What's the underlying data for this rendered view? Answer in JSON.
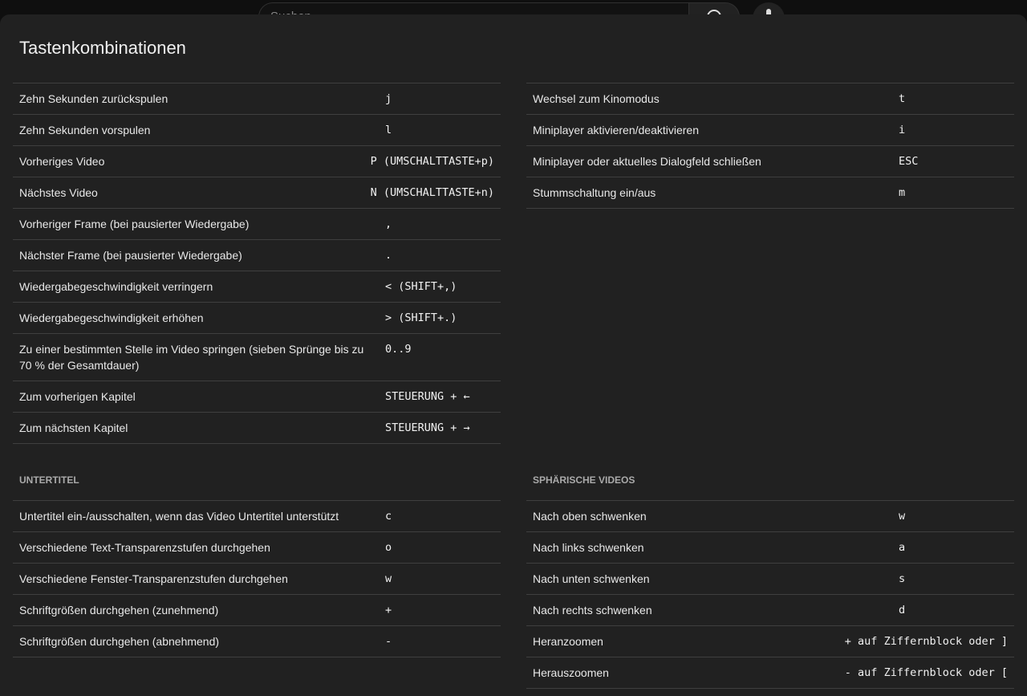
{
  "masthead": {
    "search_placeholder": "Suchen"
  },
  "dialog": {
    "title": "Tastenkombinationen"
  },
  "left_top": [
    {
      "label": "Zehn Sekunden zurückspulen",
      "key": "j"
    },
    {
      "label": "Zehn Sekunden vorspulen",
      "key": "l"
    },
    {
      "label": "Vorheriges Video",
      "key": "P (UMSCHALTTASTE+p)"
    },
    {
      "label": "Nächstes Video",
      "key": "N (UMSCHALTTASTE+n)"
    },
    {
      "label": "Vorheriger Frame (bei pausierter Wiedergabe)",
      "key": ","
    },
    {
      "label": "Nächster Frame (bei pausierter Wiedergabe)",
      "key": "."
    },
    {
      "label": "Wiedergabegeschwindigkeit verringern",
      "key": "< (SHIFT+,)"
    },
    {
      "label": "Wiedergabegeschwindigkeit erhöhen",
      "key": "> (SHIFT+.)"
    },
    {
      "label": "Zu einer bestimmten Stelle im Video springen (sieben Sprünge bis zu 70 % der Gesamtdauer)",
      "key": "0..9"
    },
    {
      "label": "Zum vorherigen Kapitel",
      "key": "STEUERUNG + ←"
    },
    {
      "label": "Zum nächsten Kapitel",
      "key": "STEUERUNG + →"
    }
  ],
  "right_top": [
    {
      "label": "Wechsel zum Kinomodus",
      "key": "t"
    },
    {
      "label": "Miniplayer aktivieren/deaktivieren",
      "key": "i"
    },
    {
      "label": "Miniplayer oder aktuelles Dialogfeld schließen",
      "key": "ESC"
    },
    {
      "label": "Stummschaltung ein/aus",
      "key": "m"
    }
  ],
  "subtitles": {
    "heading": "Untertitel",
    "rows": [
      {
        "label": "Untertitel ein-/ausschalten, wenn das Video Untertitel unterstützt",
        "key": "c"
      },
      {
        "label": "Verschiedene Text-Transparenzstufen durchgehen",
        "key": "o"
      },
      {
        "label": "Verschiedene Fenster-Transparenzstufen durchgehen",
        "key": "w"
      },
      {
        "label": "Schriftgrößen durchgehen (zunehmend)",
        "key": "+"
      },
      {
        "label": "Schriftgrößen durchgehen (abnehmend)",
        "key": "-"
      }
    ]
  },
  "spherical": {
    "heading": "Sphärische Videos",
    "rows": [
      {
        "label": "Nach oben schwenken",
        "key": "w"
      },
      {
        "label": "Nach links schwenken",
        "key": "a"
      },
      {
        "label": "Nach unten schwenken",
        "key": "s"
      },
      {
        "label": "Nach rechts schwenken",
        "key": "d"
      },
      {
        "label": "Heranzoomen",
        "key": "+ auf Ziffernblock oder ]"
      },
      {
        "label": "Herauszoomen",
        "key": "- auf Ziffernblock oder ["
      }
    ]
  }
}
